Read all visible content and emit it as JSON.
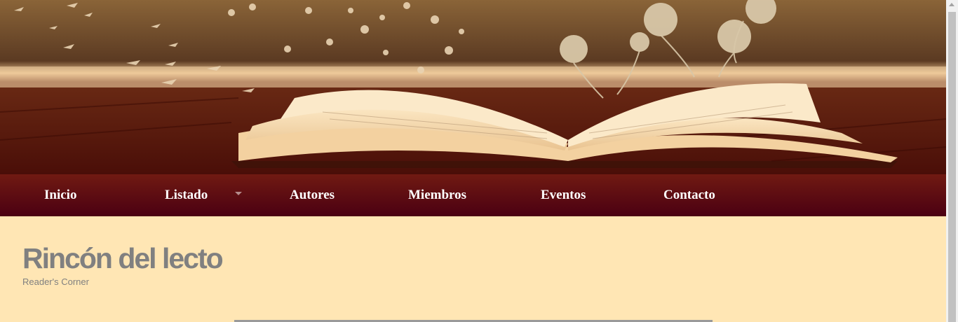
{
  "header": {
    "banner_image": "open book with butterflies and roses on wooden table"
  },
  "nav": {
    "items": [
      {
        "label": "Inicio"
      },
      {
        "label": "Listado"
      },
      {
        "label": "Autores"
      },
      {
        "label": "Miembros"
      },
      {
        "label": "Eventos"
      },
      {
        "label": "Contacto"
      }
    ]
  },
  "site": {
    "title": "Rincón del lecto",
    "subtitle": "Reader's Corner"
  },
  "colors": {
    "nav_background_top": "#701a12",
    "nav_background_bottom": "#4b0012",
    "page_background": "#ffe6b4",
    "title_text": "#808080"
  }
}
